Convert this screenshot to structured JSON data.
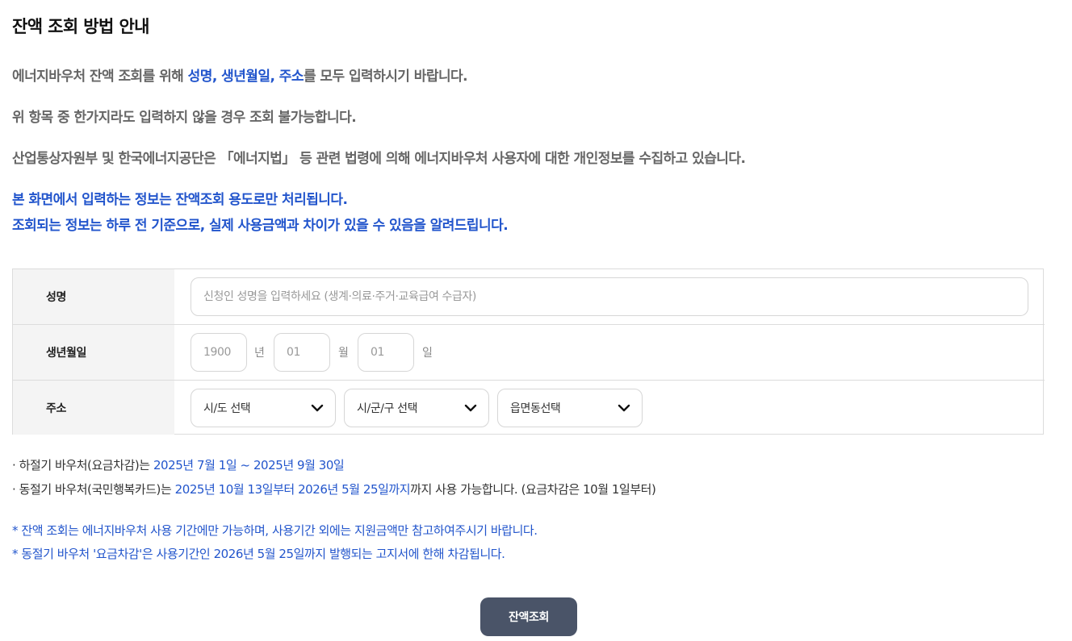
{
  "header": {
    "title": "잔액 조회 방법 안내"
  },
  "intro": {
    "line1_a": "에너지바우처 잔액 조회를 위해 ",
    "line1_b": "성명, 생년월일, 주소",
    "line1_c": "를 모두 입력하시기 바랍니다.",
    "line2": "위 항목 중 한가지라도 입력하지 않을 경우 조회 불가능합니다.",
    "line3": "산업통상자원부 및 한국에너지공단은 「에너지법」 등 관련 법령에 의해 에너지바우처 사용자에 대한 개인정보를 수집하고 있습니다.",
    "line4": "본 화면에서 입력하는 정보는 잔액조회 용도로만 처리됩니다.",
    "line5": "조회되는 정보는 하루 전 기준으로, 실제 사용금액과 차이가 있을 수 있음을 알려드립니다."
  },
  "form": {
    "name": {
      "label": "성명",
      "placeholder": "신청인 성명을 입력하세요 (생계·의료·주거·교육급여 수급자)"
    },
    "birth": {
      "label": "생년월일",
      "year_placeholder": "1900",
      "year_unit": "년",
      "month_placeholder": "01",
      "month_unit": "월",
      "day_placeholder": "01",
      "day_unit": "일"
    },
    "address": {
      "label": "주소",
      "sido": "시/도 선택",
      "sigungu": "시/군/구 선택",
      "eupmyeondong": "읍면동선택"
    }
  },
  "notes": {
    "summer_a": "· 하절기 바우처(요금차감)는 ",
    "summer_b": "2025년 7월 1일 ~ 2025년 9월 30일",
    "winter_a": "· 동절기 바우처(국민행복카드)는 ",
    "winter_b": "2025년 10월 13일부터 2026년 5월 25일까지",
    "winter_c": "까지 사용 가능합니다. (요금차감은 10월 1일부터)",
    "star1": "* 잔액 조회는 에너지바우처 사용 기간에만 가능하며, 사용기간 외에는 지원금액만 참고하여주시기 바랍니다.",
    "star2": "* 동절기 바우처 '요금차감'은 사용기간인 2026년 5월 25일까지 발행되는 고지서에 한해 차감됩니다."
  },
  "actions": {
    "submit_label": "잔액조회"
  },
  "icons": {
    "select_arrow": "chevron-down-icon"
  },
  "colors": {
    "accent_blue": "#2255cc",
    "button_bg": "#4a5468",
    "label_bg": "#f4f4f4"
  }
}
